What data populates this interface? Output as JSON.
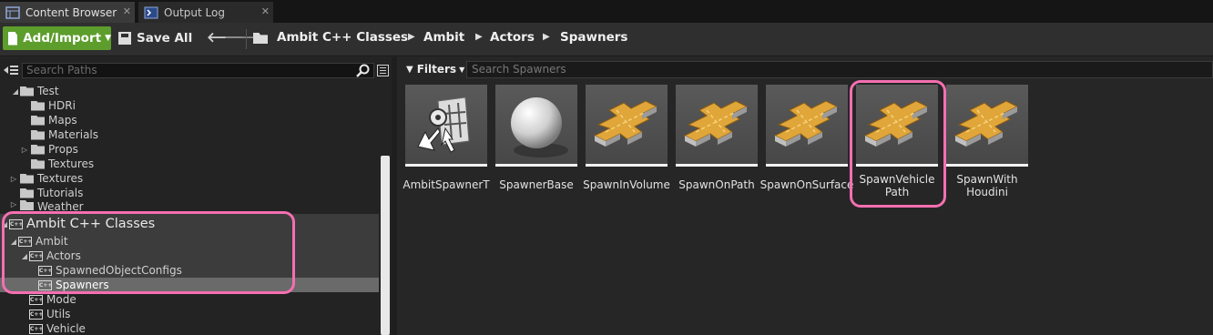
{
  "tabs": [
    {
      "label": "Content Browser",
      "icon": "content-browser-icon",
      "active": true
    },
    {
      "label": "Output Log",
      "icon": "output-log-icon",
      "active": false
    }
  ],
  "toolbar": {
    "add_import_label": "Add/Import",
    "save_all_label": "Save All",
    "breadcrumbs": [
      "Ambit C++ Classes",
      "Ambit",
      "Actors",
      "Spawners"
    ]
  },
  "sidebar": {
    "search_placeholder": "Search Paths",
    "items": [
      {
        "label": "Test"
      },
      {
        "label": "HDRi"
      },
      {
        "label": "Maps"
      },
      {
        "label": "Materials"
      },
      {
        "label": "Props"
      },
      {
        "label": "Textures"
      },
      {
        "label": "Textures"
      },
      {
        "label": "Tutorials"
      },
      {
        "label": "Weather"
      },
      {
        "label": "Ambit C++ Classes"
      },
      {
        "label": "Ambit"
      },
      {
        "label": "Actors"
      },
      {
        "label": "SpawnedObjectConfigs"
      },
      {
        "label": "Spawners"
      },
      {
        "label": "Mode"
      },
      {
        "label": "Utils"
      },
      {
        "label": "Vehicle"
      }
    ]
  },
  "content": {
    "filters_label": "Filters",
    "search_placeholder": "Search Spawners",
    "assets": [
      {
        "label": "AmbitSpawnerT",
        "icon": "spawner-tool-icon"
      },
      {
        "label": "SpawnerBase",
        "icon": "sphere-icon"
      },
      {
        "label": "SpawnInVolume",
        "icon": "road-cross-icon"
      },
      {
        "label": "SpawnOnPath",
        "icon": "road-cross-icon"
      },
      {
        "label": "SpawnOnSurface",
        "icon": "road-cross-icon"
      },
      {
        "label": "SpawnVehicle\nPath",
        "icon": "road-cross-icon"
      },
      {
        "label": "SpawnWith\nHoudini",
        "icon": "road-cross-icon"
      }
    ]
  },
  "colors": {
    "accent_green": "#5d9d2c",
    "highlight_pink": "#f56fb1",
    "road_orange": "#e0a63a"
  }
}
